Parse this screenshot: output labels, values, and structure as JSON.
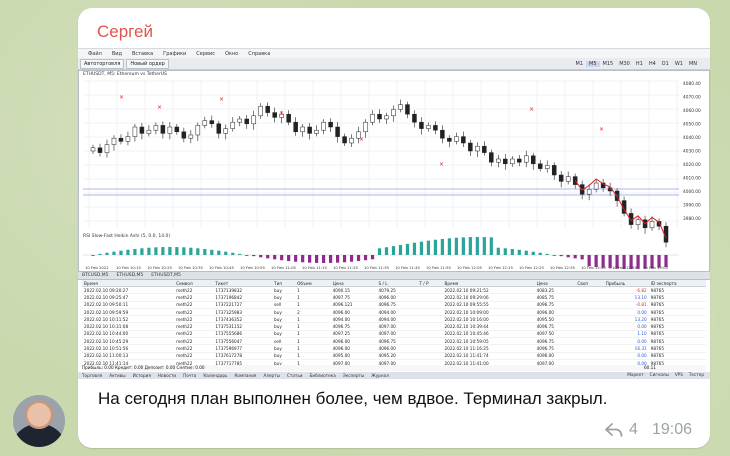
{
  "sender": "Сергей",
  "message_text": "На сегодня план выполнен более, чем вдвое. Терминал закрыл.",
  "reply_count": "4",
  "time": "19:06",
  "terminal": {
    "menu": [
      "Файл",
      "Вид",
      "Вставка",
      "Графики",
      "Сервис",
      "Окно",
      "Справка"
    ],
    "toolbar": {
      "autotrade": "Автоторговля",
      "new_order": "Новый ордер"
    },
    "timeframes": [
      "M1",
      "M5",
      "M15",
      "M30",
      "H1",
      "H4",
      "D1",
      "W1",
      "MN"
    ],
    "active_timeframe": "M5",
    "chart_title": "ETHUSDT, M5: Ethereum vs TetherUS",
    "indicator_label": "RSI Slow-Fast Heikin Ashi (5, 0.0, 14.0)",
    "price_axis": [
      "4080.40",
      "4070.00",
      "4060.00",
      "4050.00",
      "4040.00",
      "4030.00",
      "4020.00",
      "4010.00",
      "4000.00",
      "3990.00",
      "3980.00"
    ],
    "time_axis": [
      "10 Feb 2022",
      "10 Feb 10:15",
      "10 Feb 10:25",
      "10 Feb 10:35",
      "10 Feb 10:45",
      "10 Feb 10:55",
      "10 Feb 11:05",
      "10 Feb 11:15",
      "10 Feb 11:25",
      "10 Feb 11:35",
      "10 Feb 11:45",
      "10 Feb 11:55",
      "10 Feb 12:05",
      "10 Feb 12:15",
      "10 Feb 12:25",
      "10 Feb 12:35",
      "10 Feb 12:45",
      "10 Feb 12:55",
      "10 Feb 13:05"
    ],
    "chart_tabs": [
      "BTCUSD,M5",
      "ETHUSD,M5",
      "ETHUSDT,M5"
    ],
    "columns": [
      "Время",
      "Символ",
      "Тикет",
      "Тип",
      "Объем",
      "Цена",
      "S / L",
      "T / P",
      "Время",
      "Цена",
      "Своп",
      "Прибыль",
      "ID эксперта"
    ],
    "rows": [
      [
        "2022.02.10 09:20:27",
        "meth22",
        "1737139832",
        "buy",
        "1",
        "4090.15",
        "4079.25",
        "",
        "2022.02.10 09:21:52",
        "4083.25",
        "",
        "-6.82",
        "98765"
      ],
      [
        "2022.02.10 09:25:47",
        "meth22",
        "1737196842",
        "buy",
        "1",
        "4097.75",
        "4096.00",
        "",
        "2022.02.10 09:29:06",
        "4085.75",
        "",
        "13.10",
        "98765"
      ],
      [
        "2022.02.10 09:50:11",
        "meth22",
        "1737221727",
        "sell",
        "1",
        "4096.121",
        "4096.75",
        "",
        "2022.02.10 09:55:55",
        "4096.75",
        "",
        "-0.81",
        "98765"
      ],
      [
        "2022.02.10 09:59:59",
        "meth22",
        "1737325983",
        "buy",
        "2",
        "4096.00",
        "4094.00",
        "",
        "2022.02.10 10:09:00",
        "4096.00",
        "",
        "0.00",
        "98765"
      ],
      [
        "2022.02.10 10:11:52",
        "meth22",
        "1737436352",
        "buy",
        "1",
        "4094.00",
        "4094.00",
        "",
        "2022.02.10 10:16:00",
        "4095.50",
        "",
        "13.20",
        "98765"
      ],
      [
        "2022.02.10 10:31:08",
        "meth22",
        "1737531152",
        "buy",
        "1",
        "4096.75",
        "4097.00",
        "",
        "2022.02.10 10:39:44",
        "4096.75",
        "",
        "0.00",
        "98765"
      ],
      [
        "2022.02.10 10:44:00",
        "meth22",
        "1737555686",
        "buy",
        "1",
        "4097.25",
        "4097.00",
        "",
        "2022.02.10 10:45:46",
        "4097.50",
        "",
        "1.10",
        "98765"
      ],
      [
        "2022.02.10 10:45:29",
        "meth22",
        "1737556047",
        "sell",
        "1",
        "4096.00",
        "4096.75",
        "",
        "2022.02.10 10:59:05",
        "4096.75",
        "",
        "0.00",
        "98765"
      ],
      [
        "2022.02.10 10:51:56",
        "meth22",
        "1737596977",
        "buy",
        "1",
        "4096.00",
        "4096.00",
        "",
        "2022.02.10 11:16:25",
        "4096.75",
        "",
        "16.31",
        "98765"
      ],
      [
        "2022.02.10 11:00:13",
        "meth22",
        "1737617278",
        "buy",
        "1",
        "4095.00",
        "4095.20",
        "",
        "2022.02.10 11:41:74",
        "4096.00",
        "",
        "0.00",
        "98765"
      ],
      [
        "2022.02.10 11:41:14",
        "meth22",
        "1737717785",
        "buy",
        "1",
        "4097.00",
        "4097.00",
        "",
        "2022.02.10 11:41:00",
        "4097.00",
        "",
        "0.00",
        "98765"
      ]
    ],
    "balance": "Прибыль: 0.00  Кредит: 0.00  Депозит: 0.00  Снятие: 0.00",
    "balance_total": "60.11",
    "bottom_tabs": [
      "Торговля",
      "Активы",
      "История",
      "Новости",
      "Почта",
      "Календарь",
      "Компания",
      "Алерты",
      "Статьи",
      "Библиотека",
      "Эксперты",
      "Журнал"
    ],
    "status": [
      "Маркет",
      "Сигналы",
      "VPS",
      "Тестер"
    ]
  },
  "colors": {
    "bull": "#ffffff",
    "bear": "#222222",
    "ma": "#d62020",
    "histogram_pos": "#29a59a",
    "histogram_neg": "#8e2c8e",
    "sender": "#e1544c"
  },
  "icons": [
    "reply-icon",
    "avatar-photo"
  ]
}
